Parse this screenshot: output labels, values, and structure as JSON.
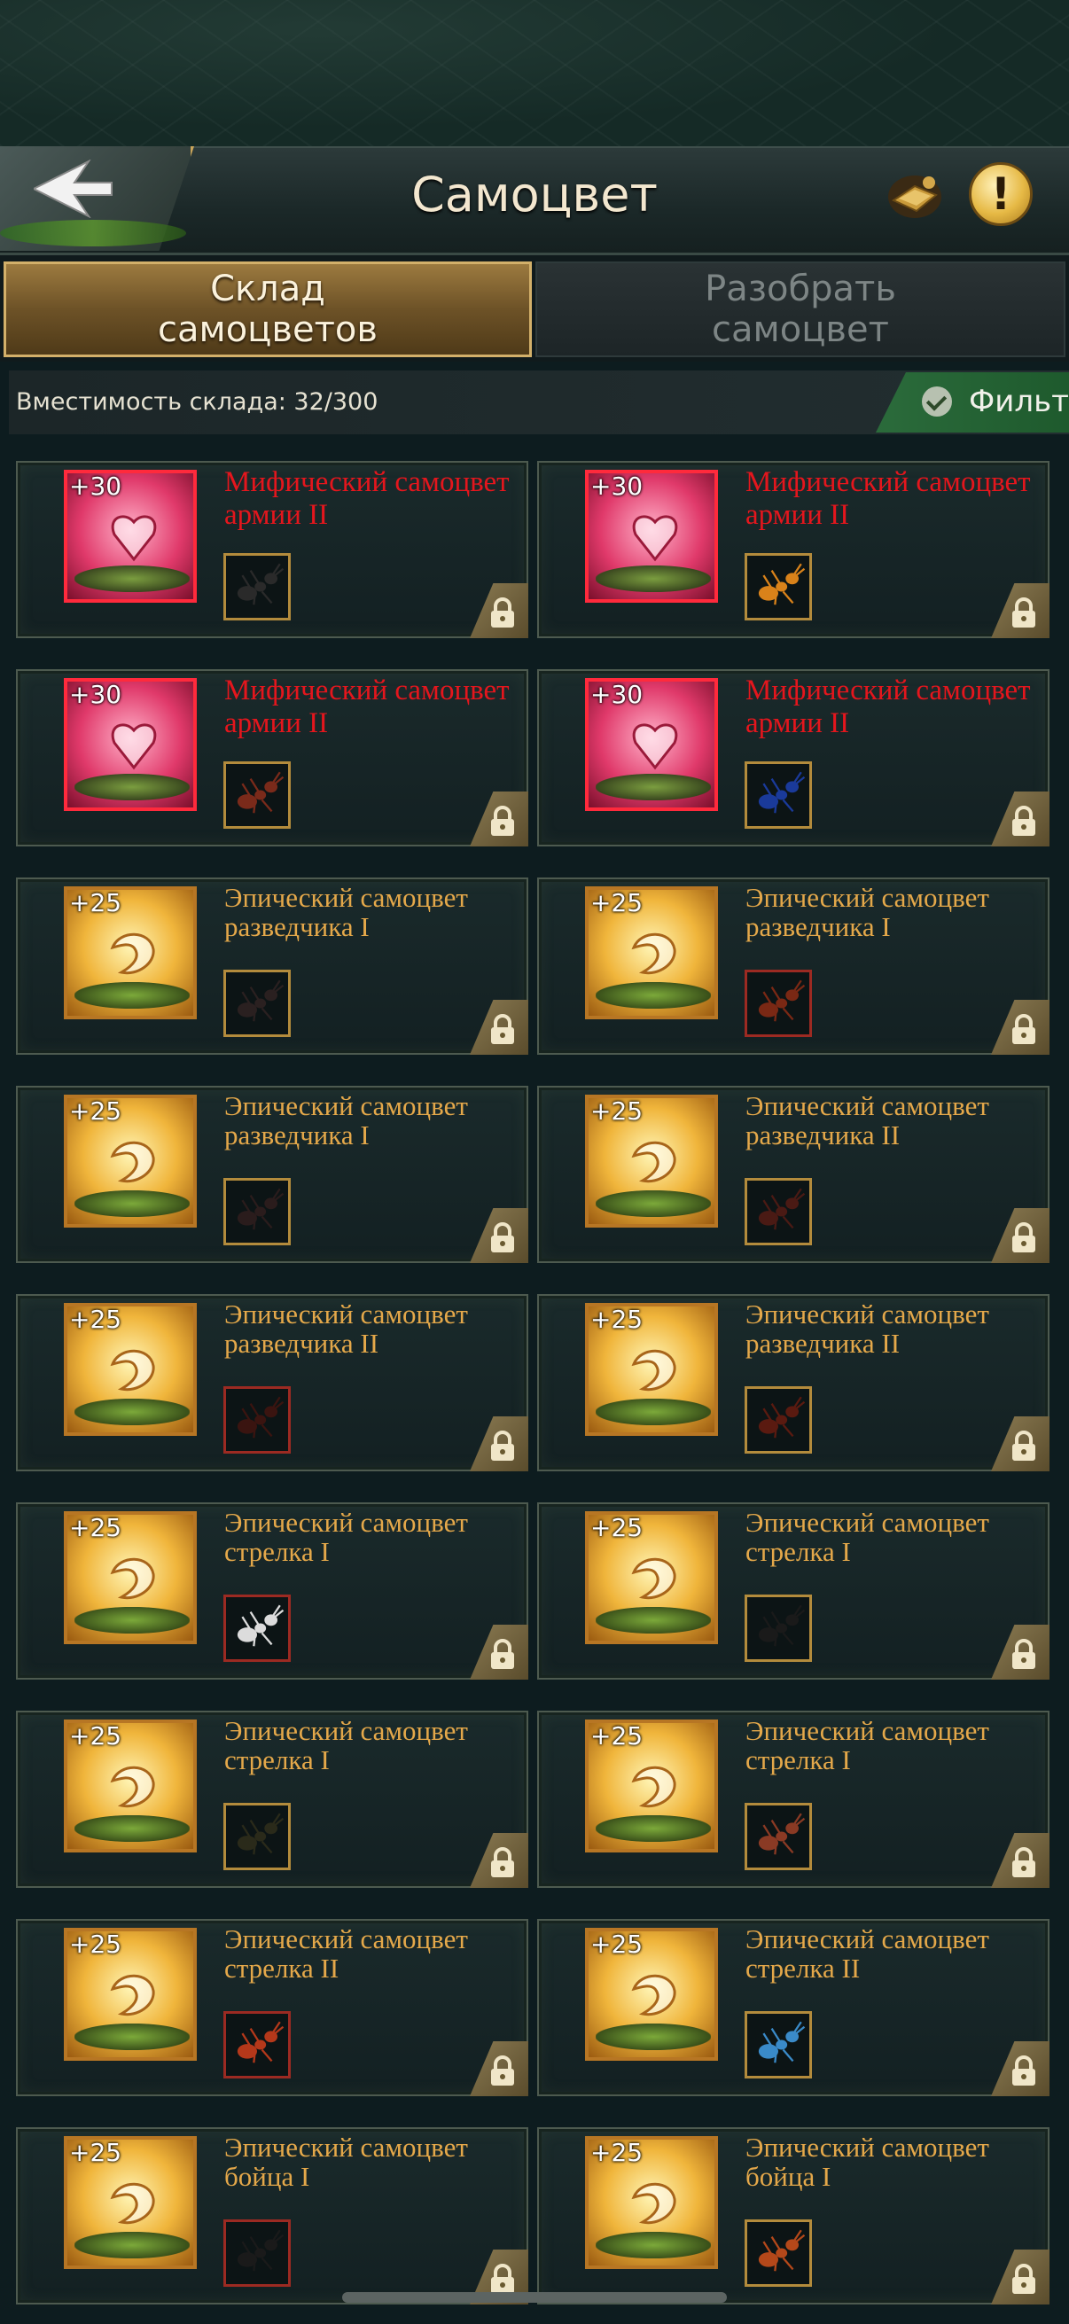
{
  "header": {
    "title": "Самоцвет"
  },
  "tabs": [
    {
      "label": "Склад\nсамоцветов",
      "active": true
    },
    {
      "label": "Разобрать\nсамоцвет",
      "active": false
    }
  ],
  "storage": {
    "capacity_text": "Вместимость склада: 32/300",
    "filter_label": "Фильт"
  },
  "colors": {
    "mythic_name": "#e4161d",
    "epic_name": "#e4a84a",
    "accent_gold": "#d3b06a",
    "filter_green": "#2b6b3b"
  },
  "gems": [
    {
      "level": "+30",
      "name": "Мифический самоцвет армии II",
      "rarity": "mythic",
      "unit_border": "gold",
      "unit_color": "#2a2a2a"
    },
    {
      "level": "+30",
      "name": "Мифический самоцвет армии II",
      "rarity": "mythic",
      "unit_border": "gold",
      "unit_color": "#d9821a"
    },
    {
      "level": "+30",
      "name": "Мифический самоцвет армии II",
      "rarity": "mythic",
      "unit_border": "gold",
      "unit_color": "#7a2a1a"
    },
    {
      "level": "+30",
      "name": "Мифический самоцвет армии II",
      "rarity": "mythic",
      "unit_border": "gold",
      "unit_color": "#1a3a9a"
    },
    {
      "level": "+25",
      "name": "Эпический самоцвет разведчика I",
      "rarity": "epic",
      "unit_border": "gold",
      "unit_color": "#2a2020"
    },
    {
      "level": "+25",
      "name": "Эпический самоцвет разведчика I",
      "rarity": "epic",
      "unit_border": "red",
      "unit_color": "#7a2814"
    },
    {
      "level": "+25",
      "name": "Эпический самоцвет разведчика I",
      "rarity": "epic",
      "unit_border": "gold",
      "unit_color": "#2a1c1c"
    },
    {
      "level": "+25",
      "name": "Эпический самоцвет разведчика II",
      "rarity": "epic",
      "unit_border": "gold",
      "unit_color": "#4a1a14"
    },
    {
      "level": "+25",
      "name": "Эпический самоцвет разведчика II",
      "rarity": "epic",
      "unit_border": "red",
      "unit_color": "#3a1410"
    },
    {
      "level": "+25",
      "name": "Эпический самоцвет разведчика II",
      "rarity": "epic",
      "unit_border": "gold",
      "unit_color": "#5a1a10"
    },
    {
      "level": "+25",
      "name": "Эпический самоцвет стрелка I",
      "rarity": "epic",
      "unit_border": "red",
      "unit_color": "#dcdcdc"
    },
    {
      "level": "+25",
      "name": "Эпический самоцвет стрелка I",
      "rarity": "epic",
      "unit_border": "gold",
      "unit_color": "#1a1a1a"
    },
    {
      "level": "+25",
      "name": "Эпический самоцвет стрелка I",
      "rarity": "epic",
      "unit_border": "gold",
      "unit_color": "#2a2a1a"
    },
    {
      "level": "+25",
      "name": "Эпический самоцвет стрелка I",
      "rarity": "epic",
      "unit_border": "gold",
      "unit_color": "#8a3a24"
    },
    {
      "level": "+25",
      "name": "Эпический самоцвет стрелка II",
      "rarity": "epic",
      "unit_border": "red",
      "unit_color": "#b4381a"
    },
    {
      "level": "+25",
      "name": "Эпический самоцвет стрелка II",
      "rarity": "epic",
      "unit_border": "gold",
      "unit_color": "#3a8ac8"
    },
    {
      "level": "+25",
      "name": "Эпический самоцвет бойца I",
      "rarity": "epic",
      "unit_border": "red",
      "unit_color": "#1a1a1a"
    },
    {
      "level": "+25",
      "name": "Эпический самоцвет бойца I",
      "rarity": "epic",
      "unit_border": "gold",
      "unit_color": "#b4481a"
    }
  ]
}
